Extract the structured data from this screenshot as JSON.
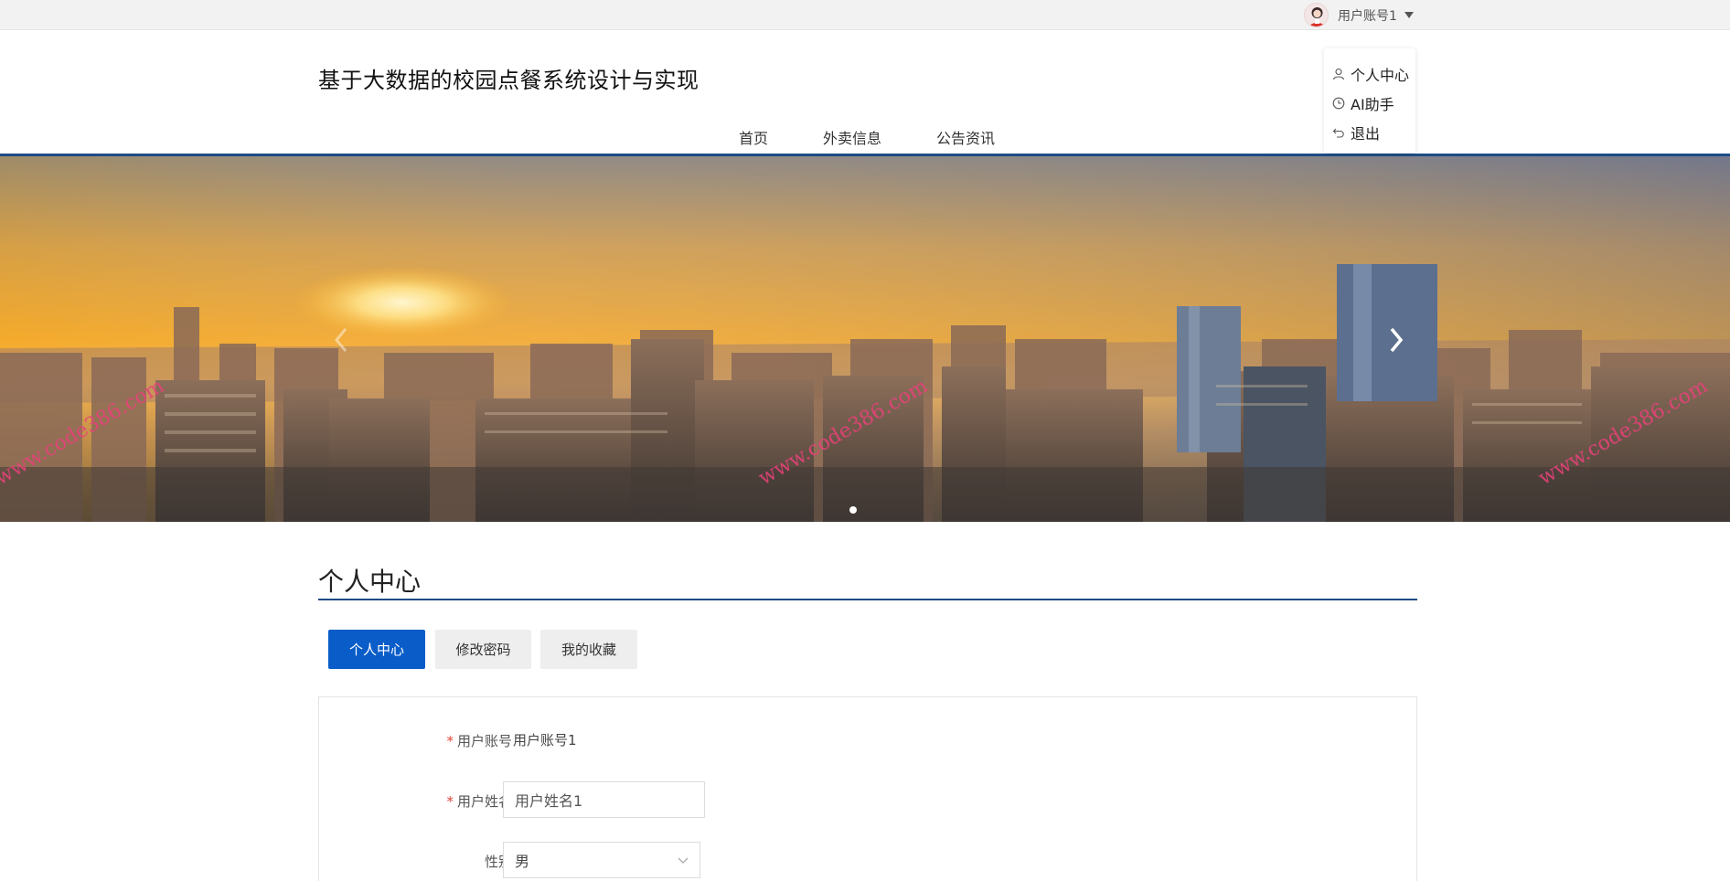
{
  "topbar": {
    "account_name": "用户账号1",
    "avatar_icon": "user-avatar",
    "caret_icon": "caret-down-icon"
  },
  "dropdown": {
    "items": [
      {
        "label": "个人中心",
        "icon": "user-icon"
      },
      {
        "label": "AI助手",
        "icon": "clock-icon"
      },
      {
        "label": "退出",
        "icon": "undo-icon"
      }
    ]
  },
  "header": {
    "title": "基于大数据的校园点餐系统设计与实现",
    "nav": [
      "首页",
      "外卖信息",
      "公告资讯"
    ]
  },
  "banner": {
    "watermark": "www.code386.com",
    "prev_icon": "chevron-left-icon",
    "next_icon": "chevron-right-icon",
    "slide_count": 1,
    "active_slide": 1
  },
  "profile": {
    "section_title": "个人中心",
    "tabs": [
      {
        "label": "个人中心",
        "active": true
      },
      {
        "label": "修改密码",
        "active": false
      },
      {
        "label": "我的收藏",
        "active": false
      }
    ],
    "fields": {
      "account": {
        "label": "用户账号",
        "required": "*",
        "value": "用户账号1"
      },
      "name": {
        "label": "用户姓名",
        "required": "*",
        "value": "用户姓名1"
      },
      "gender": {
        "label": "性别",
        "value": "男"
      }
    }
  },
  "colors": {
    "brand": "#1d4b86",
    "tab_active": "#0a5dc8",
    "required": "#e0433b"
  }
}
